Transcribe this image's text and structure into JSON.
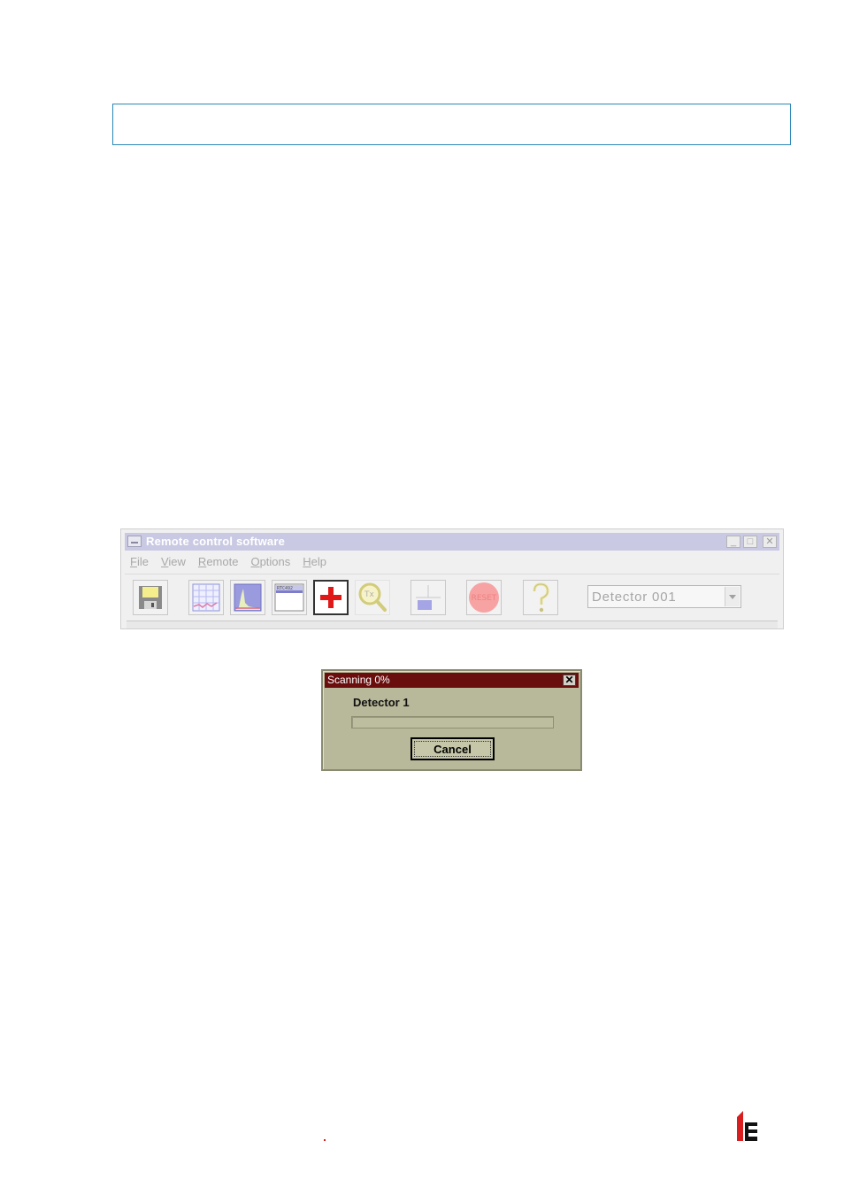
{
  "app": {
    "title": "Remote control software",
    "window_buttons": {
      "minimize": "_",
      "maximize": "□",
      "close": "✕"
    },
    "menu": [
      "File",
      "View",
      "Remote",
      "Options",
      "Help"
    ],
    "toolbar": [
      {
        "name": "save-icon"
      },
      {
        "name": "grid-chart-icon"
      },
      {
        "name": "spectrum-chart-icon"
      },
      {
        "name": "window-panel-icon"
      },
      {
        "name": "red-cross-icon"
      },
      {
        "name": "tx-magnifier-icon"
      },
      {
        "name": "display-icon"
      },
      {
        "name": "reset-icon",
        "label": "RESET"
      },
      {
        "name": "help-icon"
      }
    ],
    "detector_select": {
      "value": "Detector 001"
    }
  },
  "dialog": {
    "title": "Scanning 0%",
    "close_label": "✕",
    "detector_label": "Detector 1",
    "progress": 0,
    "cancel_label": "Cancel",
    "title_color": "#6a0d0d"
  },
  "colors": {
    "app_titlebar": "#c9c9e4",
    "header_border": "#2b87b8",
    "logo_red": "#d81e1e"
  }
}
